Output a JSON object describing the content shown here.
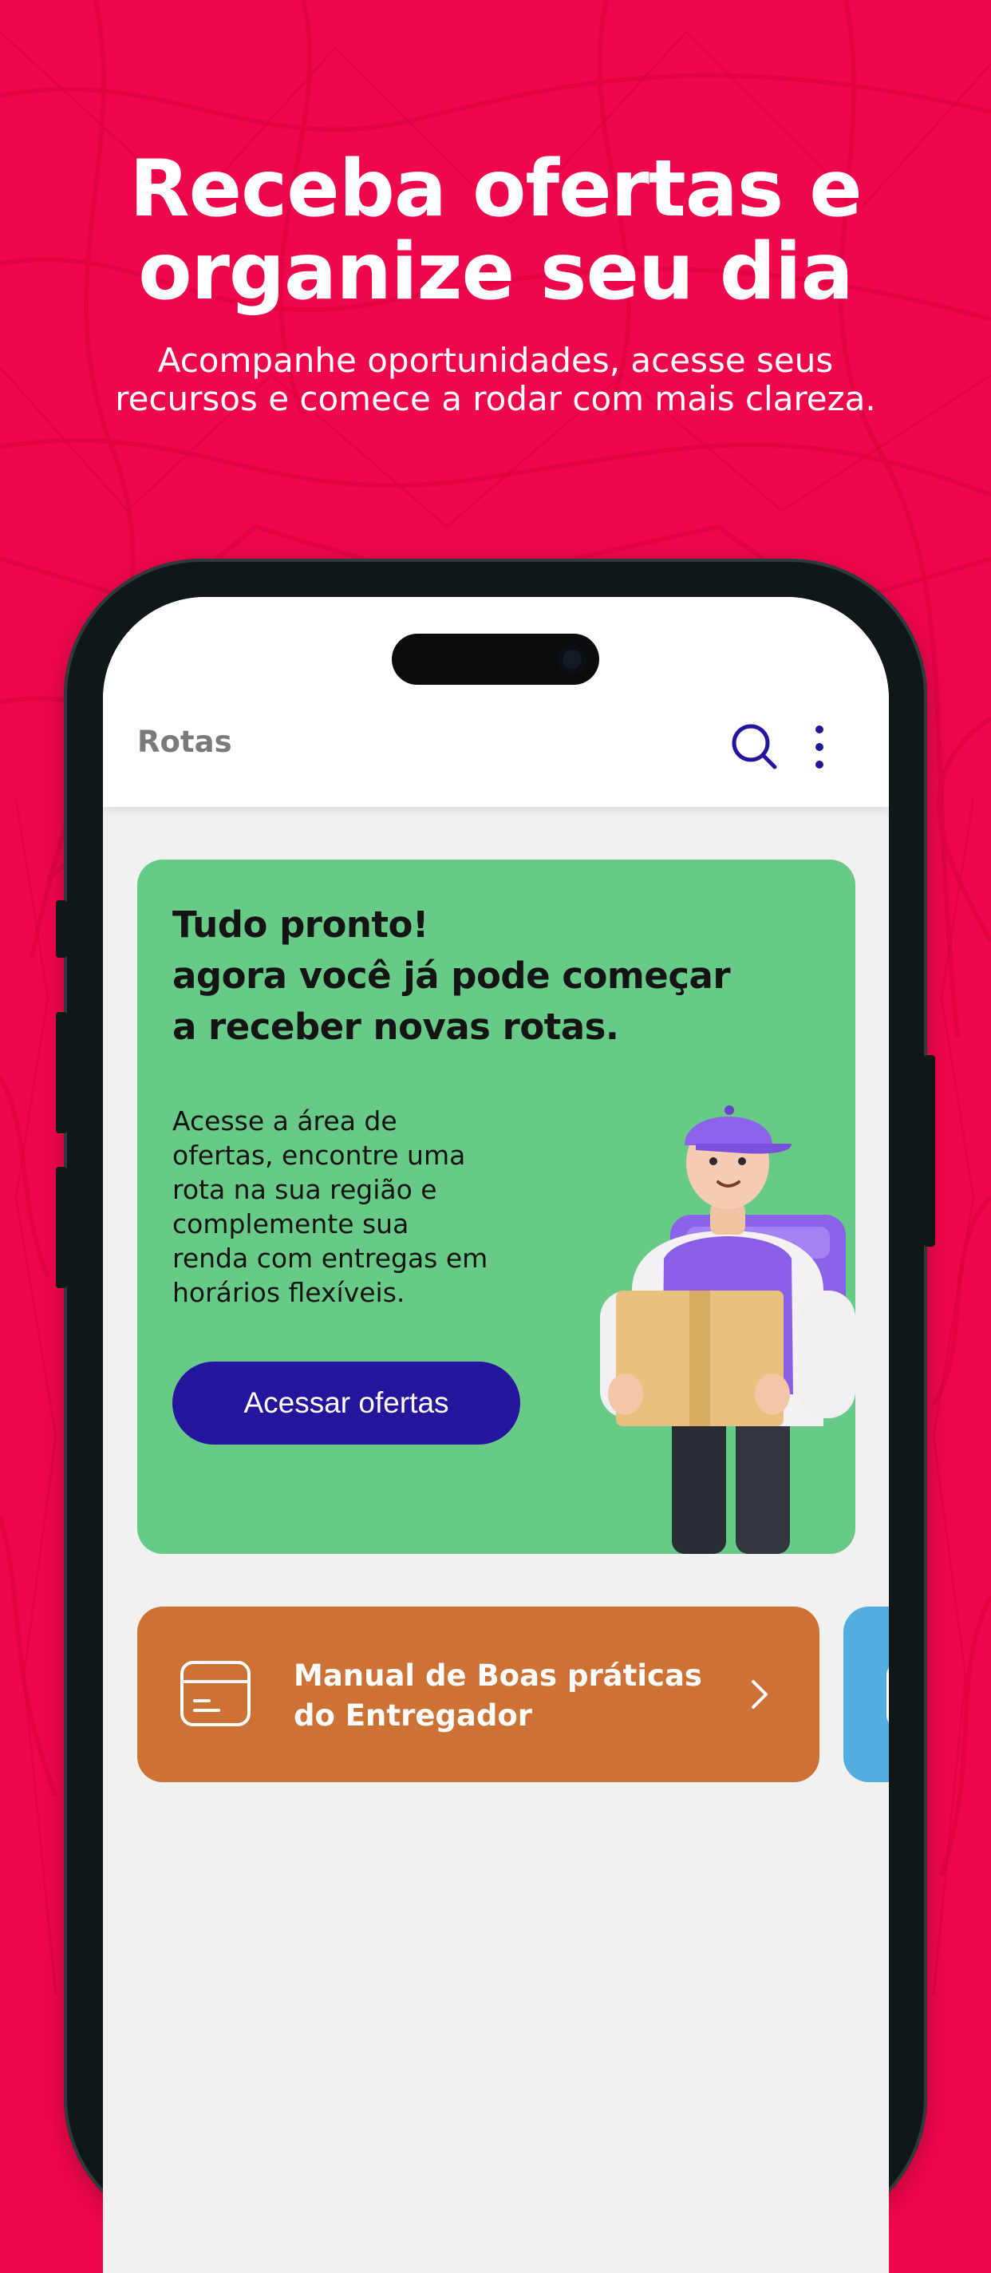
{
  "marketing": {
    "headline_line1": "Receba ofertas e",
    "headline_line2": "organize seu dia",
    "subline_line1": "Acompanhe oportunidades, acesse seus",
    "subline_line2": "recursos e comece a rodar com mais clareza."
  },
  "app": {
    "title": "Rotas",
    "icons": {
      "search": "search-icon",
      "more": "more-vertical-icon"
    },
    "accent_color": "#24169c"
  },
  "promo": {
    "title_line1": "Tudo pronto!",
    "title_line2": "agora você já pode começar",
    "title_line3": "a receber novas rotas.",
    "text_line1": "Acesse a área de",
    "text_line2": "ofertas, encontre uma",
    "text_line3": "rota na sua região e",
    "text_line4": "complemente sua",
    "text_line5": "renda com entregas em",
    "text_line6": "horários flexíveis.",
    "cta_label": "Acessar ofertas",
    "background_color": "#67cb87"
  },
  "resources": {
    "cards": [
      {
        "label_line1": "Manual de Boas práticas",
        "label_line2": "do Entregador",
        "icon": "box-icon",
        "color": "#cd7134"
      },
      {
        "icon": "box-icon",
        "color": "#53aee0"
      }
    ]
  },
  "colors": {
    "brand_background": "#f0074b"
  }
}
